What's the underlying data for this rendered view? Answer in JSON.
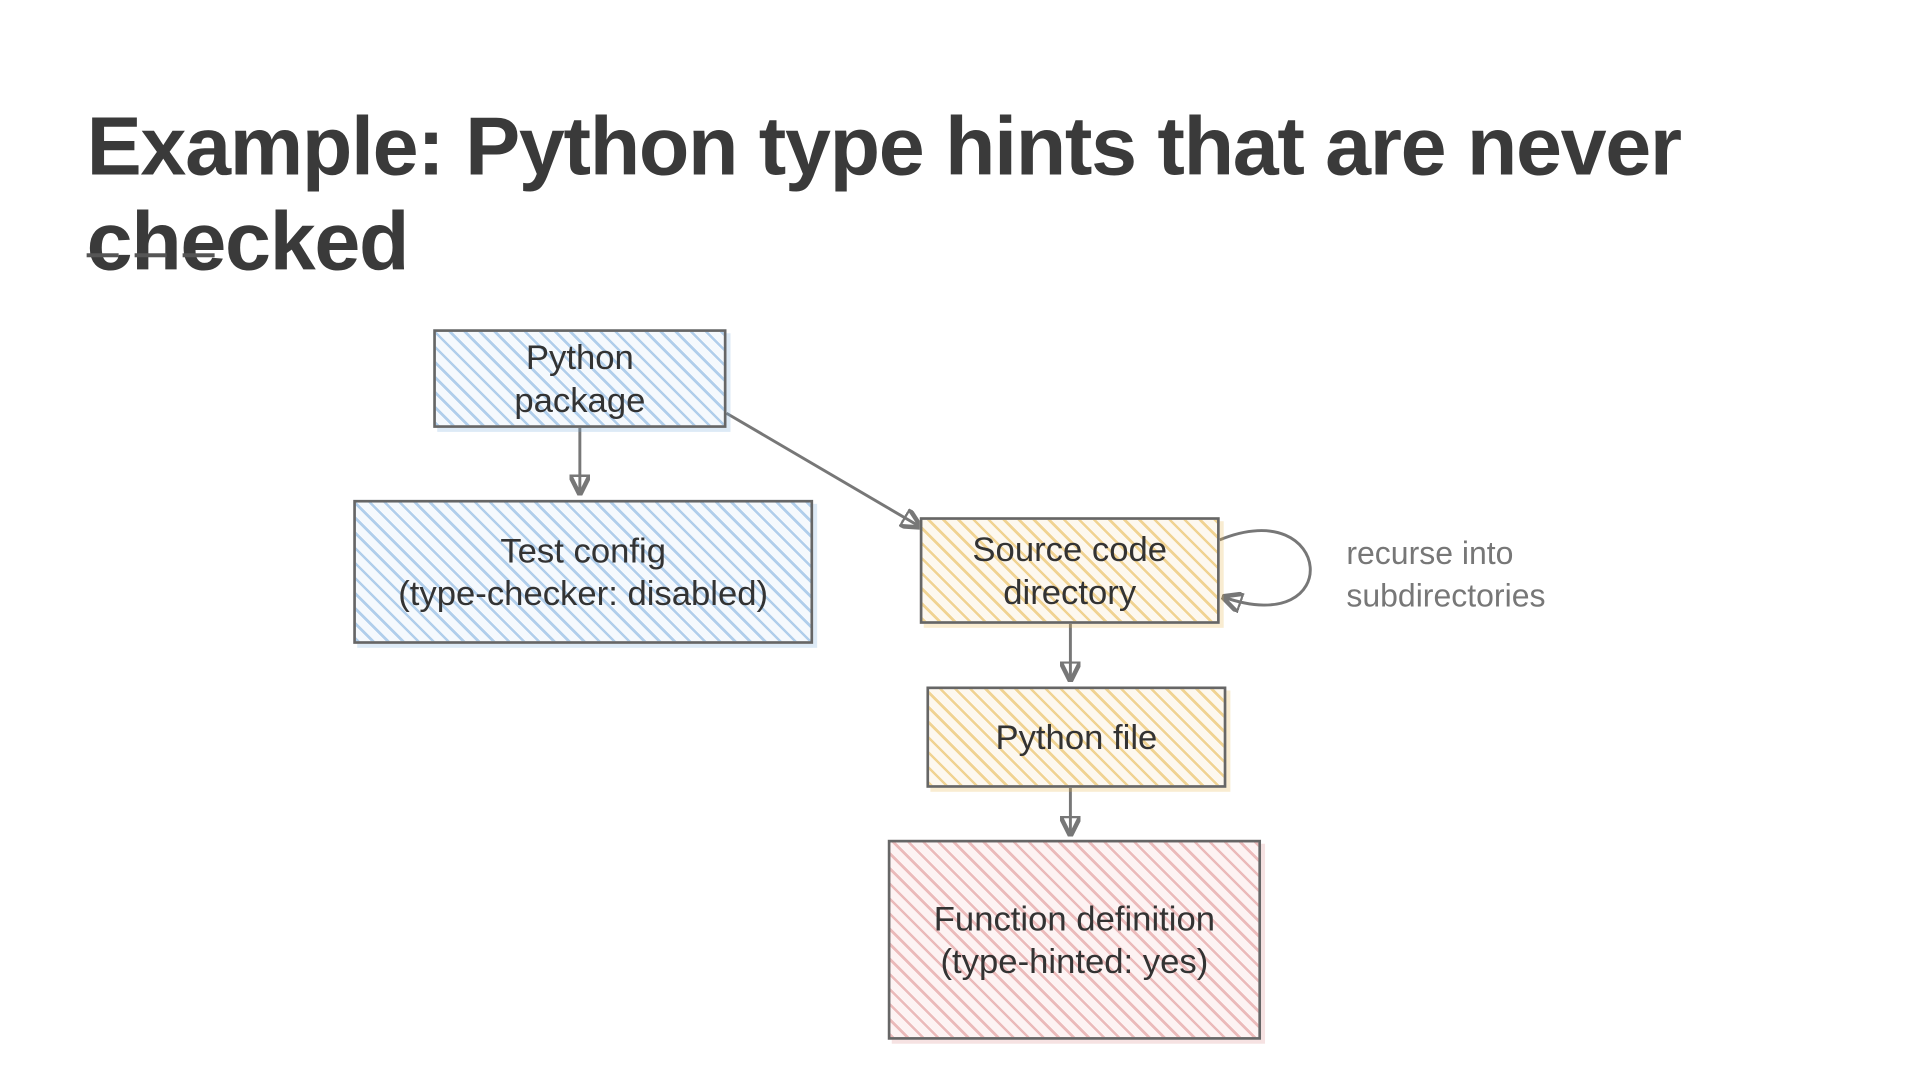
{
  "title": "Example: Python type hints that are never checked",
  "nodes": {
    "package": "Python\npackage",
    "testcfg": "Test config\n(type-checker: disabled)",
    "srcdir": "Source code\ndirectory",
    "pyfile": "Python file",
    "funcdef": "Function definition\n(type-hinted: yes)"
  },
  "annotation": "recurse into\nsubdirectories",
  "colors": {
    "blue": "#8ab5dd",
    "yellow": "#e8b656",
    "red": "#e0a0a0",
    "ink": "#777777"
  }
}
